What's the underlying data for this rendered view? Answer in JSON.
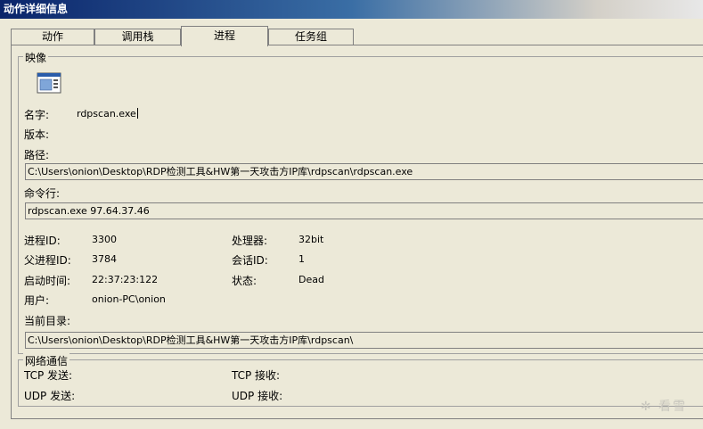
{
  "window": {
    "title": "动作详细信息"
  },
  "tabs": [
    {
      "label": "动作"
    },
    {
      "label": "调用栈"
    },
    {
      "label": "进程"
    },
    {
      "label": "任务组"
    }
  ],
  "image_group": {
    "title": "映像",
    "icon": "executable-file-icon",
    "name_label": "名字:",
    "name_value": "rdpscan.exe",
    "version_label": "版本:",
    "path_label": "路径:",
    "path_value": "C:\\Users\\onion\\Desktop\\RDP检测工具&HW第一天攻击方IP库\\rdpscan\\rdpscan.exe",
    "cmdline_label": "命令行:",
    "cmdline_value": "rdpscan.exe  97.64.37.46"
  },
  "process_info": {
    "pid_label": "进程ID:",
    "pid_value": "3300",
    "ppid_label": "父进程ID:",
    "ppid_value": "3784",
    "start_label": "启动时间:",
    "start_value": "22:37:23:122",
    "user_label": "用户:",
    "user_value": "onion-PC\\onion",
    "cpu_label": "处理器:",
    "cpu_value": "32bit",
    "session_label": "会话ID:",
    "session_value": "1",
    "state_label": "状态:",
    "state_value": "Dead",
    "cwd_label": "当前目录:",
    "cwd_value": "C:\\Users\\onion\\Desktop\\RDP检测工具&HW第一天攻击方IP库\\rdpscan\\"
  },
  "network_group": {
    "title": "网络通信",
    "tcp_send_label": "TCP 发送:",
    "tcp_recv_label": "TCP 接收:",
    "udp_send_label": "UDP 发送:",
    "udp_recv_label": "UDP 接收:"
  },
  "watermark": "看雪"
}
